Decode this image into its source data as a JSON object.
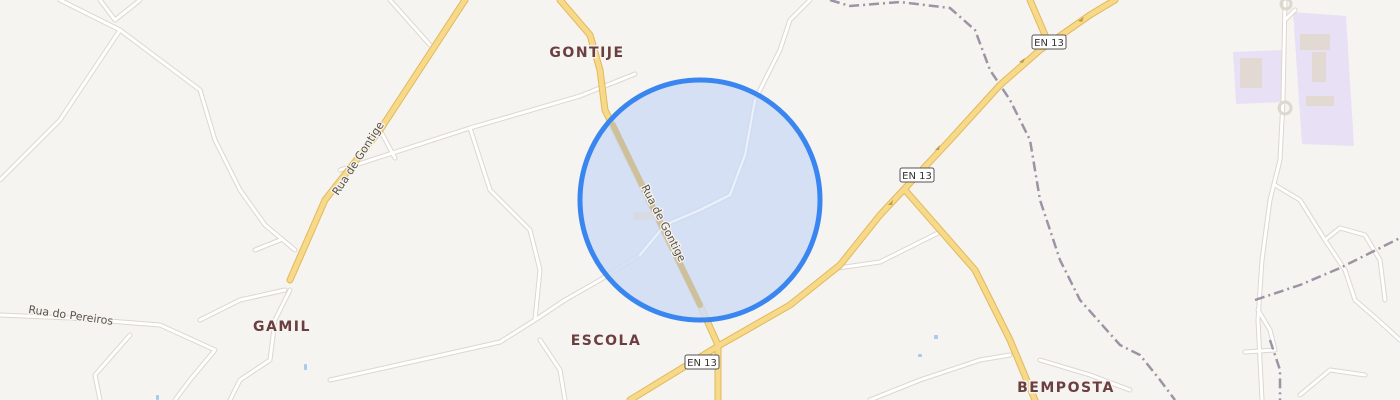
{
  "map": {
    "places": {
      "gontije": "GONTIJE",
      "gamil": "GAMIL",
      "escola": "ESCOLA",
      "bemposta": "BEMPOSTA"
    },
    "streets": {
      "rua_de_gontige_main": "Rua de Gontige",
      "rua_de_gontige_west": "Rua de Gontige",
      "rua_do_pereiros": "Rua do Pereiros"
    },
    "route_shields": {
      "top": "EN 13",
      "middle": "EN 13",
      "bottom": "EN 13"
    },
    "location_marker": {
      "fill_color": "#cfdcf4",
      "stroke_color": "#3a86f0"
    },
    "colors": {
      "background": "#f6f4f0",
      "major_road": "#f6d27c",
      "minor_road": "#ffffff",
      "boundary": "#9c94a4",
      "campus": "#e8e0f4"
    }
  }
}
